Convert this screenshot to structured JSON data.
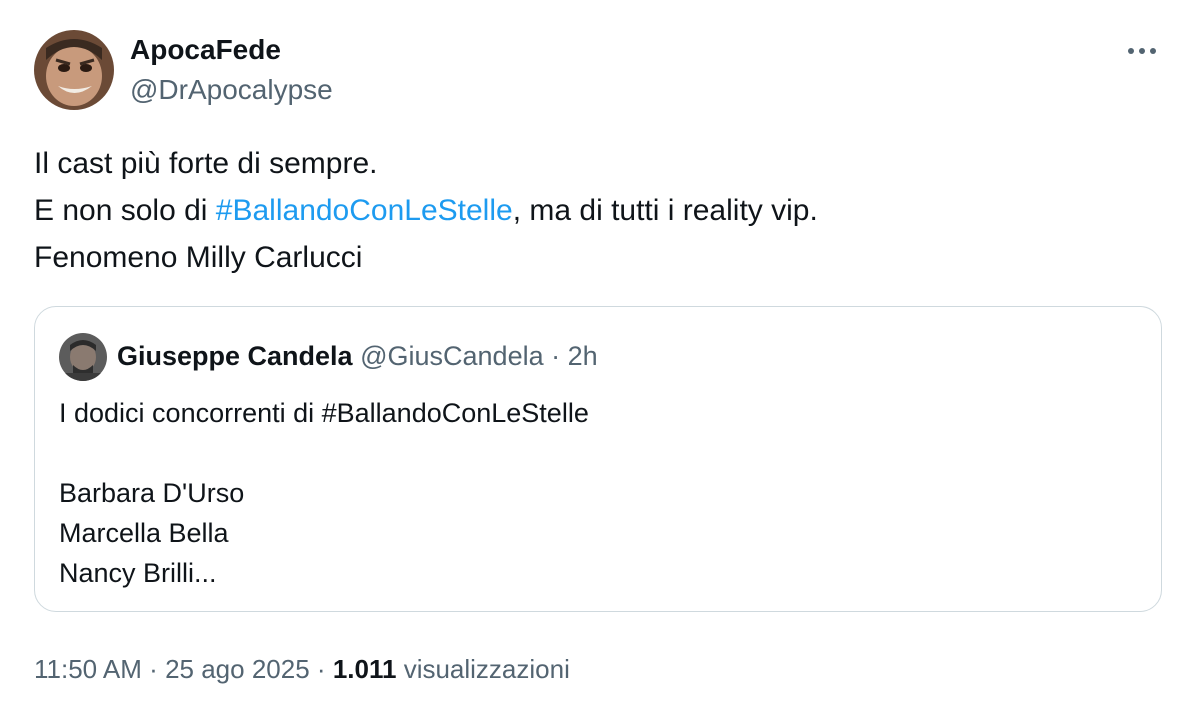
{
  "author": {
    "display_name": "ApocaFede",
    "handle": "@DrApocalypse",
    "avatar_icon": "profile-photo"
  },
  "tweet": {
    "line1": "Il cast più forte di sempre.",
    "line2_prefix": "E non solo di ",
    "line2_hashtag": "#BallandoConLeStelle",
    "line2_suffix": ", ma di tutti i reality vip.",
    "line3": "Fenomeno Milly Carlucci"
  },
  "quoted_tweet": {
    "display_name": "Giuseppe Candela",
    "handle": "@GiusCandela",
    "separator": "·",
    "time": "2h",
    "lines": [
      "I dodici concorrenti di #BallandoConLeStelle",
      "Barbara D'Urso",
      "Marcella Bella",
      "Nancy Brilli..."
    ]
  },
  "meta": {
    "time": "11:50 AM",
    "separator": "·",
    "date": "25 ago 2025",
    "views_count": "1.011",
    "views_label": "visualizzazioni"
  },
  "menu": {
    "more_icon": "more-horizontal-icon"
  },
  "colors": {
    "text_primary": "#0f1419",
    "text_secondary": "#536471",
    "link": "#1d9bf0",
    "border": "#cfd9de"
  }
}
